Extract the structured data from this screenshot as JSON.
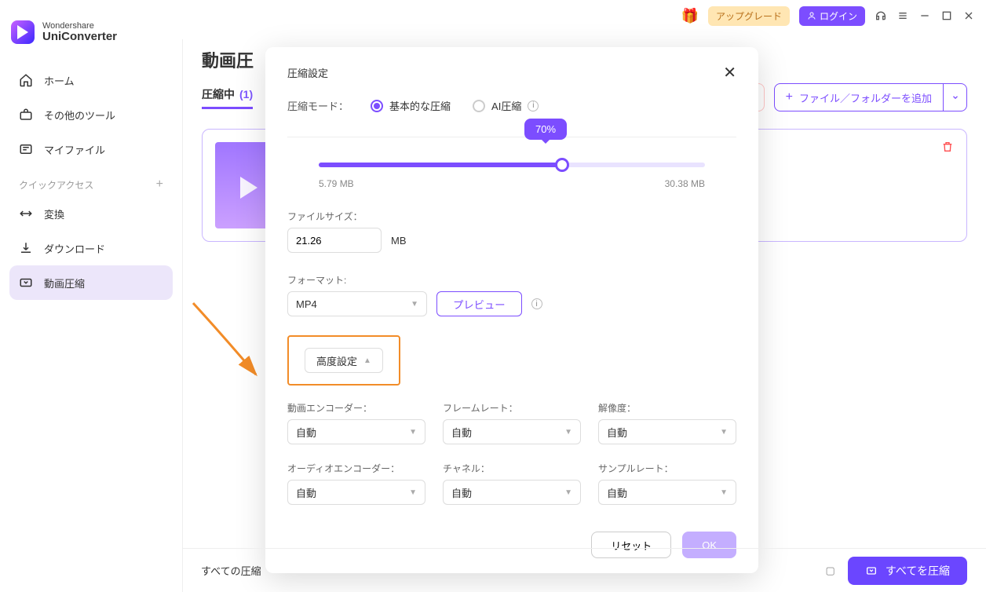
{
  "titlebar": {
    "upgrade": "アップグレード",
    "login": "ログイン"
  },
  "logo": {
    "brand": "Wondershare",
    "product": "UniConverter"
  },
  "sidebar": {
    "items": [
      {
        "label": "ホーム"
      },
      {
        "label": "その他のツール"
      },
      {
        "label": "マイファイル"
      }
    ],
    "quick_label": "クイックアクセス",
    "quick_items": [
      {
        "label": "変換"
      },
      {
        "label": "ダウンロード"
      },
      {
        "label": "動画圧縮"
      }
    ]
  },
  "main": {
    "title": "動画圧",
    "tab_label": "圧縮中",
    "tab_count": "(1)",
    "add_label": "ファイル／フォルダーを追加"
  },
  "modal": {
    "title": "圧縮設定",
    "mode_label": "圧縮モード：",
    "mode_basic": "基本的な圧縮",
    "mode_ai": "AI圧縮",
    "slider": {
      "percent": "70%",
      "min": "5.79 MB",
      "max": "30.38 MB"
    },
    "filesize_label": "ファイルサイズ：",
    "filesize_value": "21.26",
    "filesize_unit": "MB",
    "format_label": "フォーマット:",
    "format_value": "MP4",
    "preview": "プレビュー",
    "advanced": "高度設定",
    "vcodec_label": "動画エンコーダー：",
    "vcodec": "自動",
    "fps_label": "フレームレート：",
    "fps": "自動",
    "res_label": "解像度：",
    "res": "自動",
    "acodec_label": "オーディオエンコーダー：",
    "acodec": "自動",
    "channel_label": "チャネル：",
    "channel": "自動",
    "sample_label": "サンプルレート：",
    "sample": "自動",
    "reset": "リセット",
    "ok": "OK"
  },
  "bottom": {
    "left": "すべての圧縮",
    "all": "すべてを圧縮"
  }
}
